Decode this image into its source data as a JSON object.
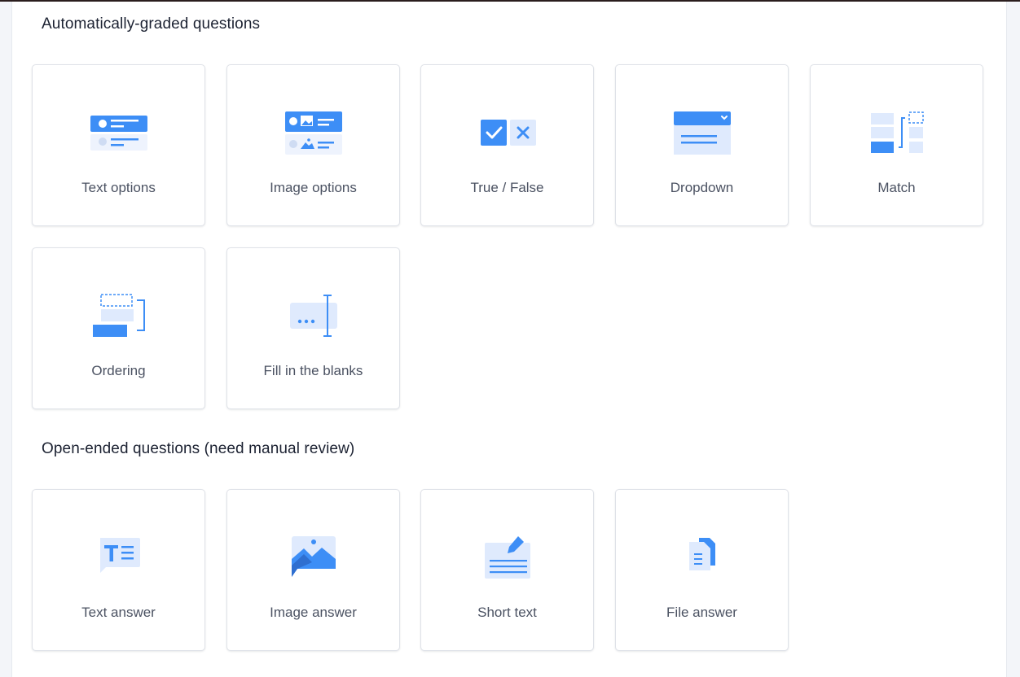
{
  "auto_section": {
    "title": "Automatically-graded questions",
    "cards": [
      {
        "label": "Text options",
        "icon": "text-options-icon"
      },
      {
        "label": "Image options",
        "icon": "image-options-icon"
      },
      {
        "label": "True / False",
        "icon": "true-false-icon"
      },
      {
        "label": "Dropdown",
        "icon": "dropdown-icon"
      },
      {
        "label": "Match",
        "icon": "match-icon"
      },
      {
        "label": "Ordering",
        "icon": "ordering-icon"
      },
      {
        "label": "Fill in the blanks",
        "icon": "fill-blanks-icon"
      }
    ]
  },
  "open_section": {
    "title": "Open-ended questions (need manual review)",
    "cards": [
      {
        "label": "Text answer",
        "icon": "text-answer-icon"
      },
      {
        "label": "Image answer",
        "icon": "image-answer-icon"
      },
      {
        "label": "Short text",
        "icon": "short-text-icon"
      },
      {
        "label": "File answer",
        "icon": "file-answer-icon"
      }
    ]
  },
  "colors": {
    "accent": "#3d8ef6",
    "accent_light": "#dfeafd",
    "label_text": "#4b5262",
    "heading_text": "#1c2232"
  }
}
